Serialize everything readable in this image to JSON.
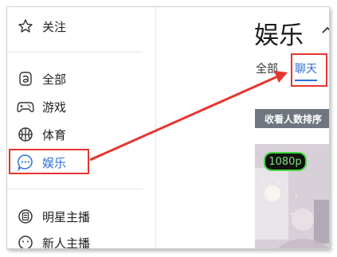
{
  "sidebar": {
    "follow": {
      "label": "关注",
      "icon": "star-icon"
    },
    "items": [
      {
        "label": "全部",
        "icon": "letter-a-icon"
      },
      {
        "label": "游戏",
        "icon": "gamepad-icon"
      },
      {
        "label": "体育",
        "icon": "basketball-icon"
      },
      {
        "label": "娱乐",
        "icon": "chat-bubble-icon",
        "active": true
      }
    ],
    "streamers": [
      {
        "label": "明星主播",
        "icon": "star-badge-icon"
      },
      {
        "label": "新人主播",
        "icon": "smiley-icon"
      }
    ]
  },
  "main": {
    "title": "娱乐",
    "tabs": [
      {
        "label": "全部"
      },
      {
        "label": "聊天",
        "active": true
      }
    ],
    "sort_label": "收看人数排序",
    "thumbnail": {
      "quality_badge": "1080p"
    }
  },
  "colors": {
    "accent": "#2d6fd6",
    "annotation": "#e53530",
    "sort_bg": "#6f7680"
  }
}
